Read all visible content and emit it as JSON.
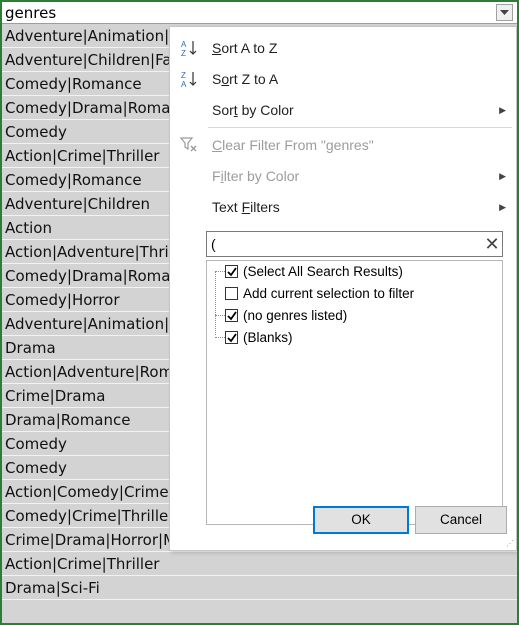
{
  "header": {
    "column_name": "genres"
  },
  "rows": [
    "Adventure|Animation|Children|Comedy|Fantasy",
    "Adventure|Children|Fantasy",
    "Comedy|Romance",
    "Comedy|Drama|Romance",
    "Comedy",
    "Action|Crime|Thriller",
    "Comedy|Romance",
    "Adventure|Children",
    "Action",
    "Action|Adventure|Thriller",
    "Comedy|Drama|Romance",
    "Comedy|Horror",
    "Adventure|Animation|Children",
    "Drama",
    "Action|Adventure|Romance",
    "Crime|Drama",
    "Drama|Romance",
    "Comedy",
    "Comedy",
    "Action|Comedy|Crime|Drama|Thriller",
    "Comedy|Crime|Thriller",
    "Crime|Drama|Horror|Mystery|Thriller",
    "Action|Crime|Thriller",
    "Drama|Sci-Fi"
  ],
  "menu": {
    "sort_az_pre": "",
    "sort_az_key": "S",
    "sort_az_post": "ort A to Z",
    "sort_za_pre": "S",
    "sort_za_key": "o",
    "sort_za_post": "rt Z to A",
    "sort_color_pre": "Sor",
    "sort_color_key": "t",
    "sort_color_post": " by Color",
    "clear_pre": "",
    "clear_key": "C",
    "clear_post": "lear Filter From \"genres\"",
    "filter_color_pre": "F",
    "filter_color_key": "i",
    "filter_color_post": "lter by Color",
    "text_filters_pre": "Text ",
    "text_filters_key": "F",
    "text_filters_post": "ilters",
    "search_value": "("
  },
  "checklist": [
    {
      "label": "(Select All Search Results)",
      "checked": true
    },
    {
      "label": "Add current selection to filter",
      "checked": false
    },
    {
      "label": "(no genres listed)",
      "checked": true
    },
    {
      "label": "(Blanks)",
      "checked": true
    }
  ],
  "buttons": {
    "ok": "OK",
    "cancel": "Cancel"
  },
  "colors": {
    "frame_border": "#2e7d32",
    "row_bg": "#d3d3d3",
    "ok_border": "#0078d7"
  },
  "icons": [
    "dropdown-arrow-icon",
    "sort-az-icon",
    "sort-za-icon",
    "clear-filter-icon",
    "submenu-arrow-icon",
    "clear-search-icon",
    "check-icon",
    "resize-grip-icon"
  ]
}
